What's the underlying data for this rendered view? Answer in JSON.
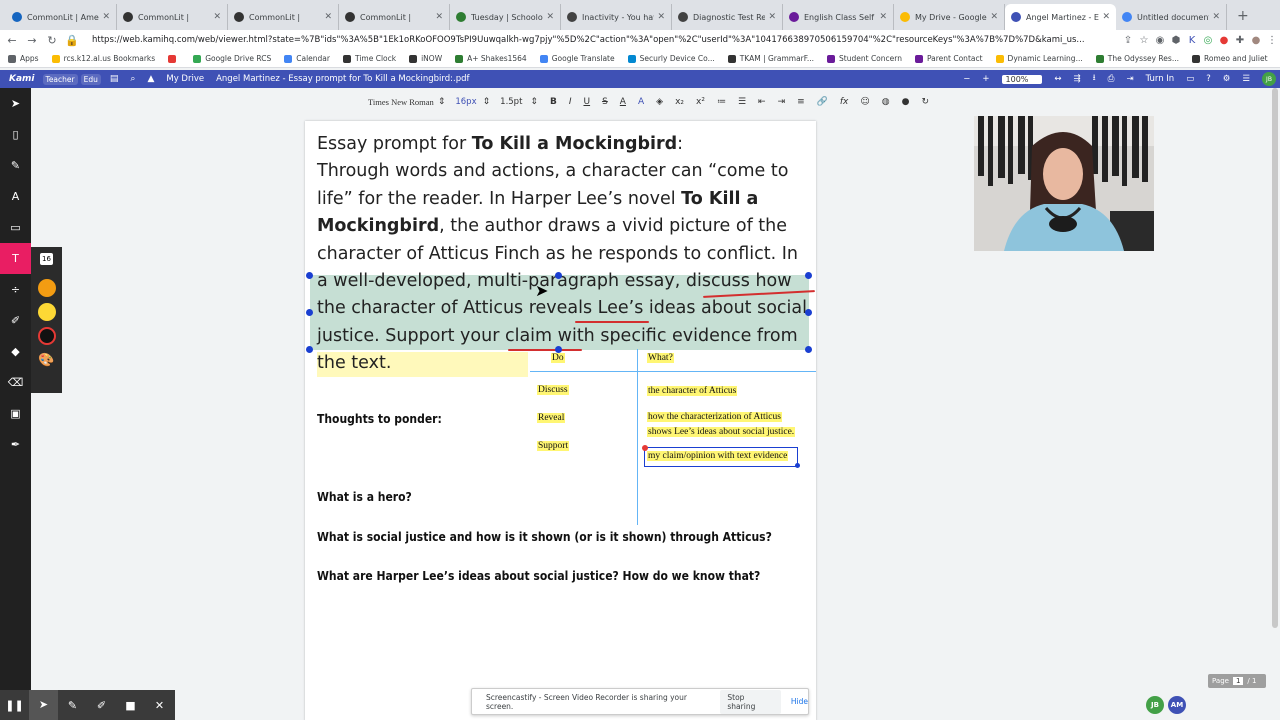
{
  "browser": {
    "tabs": [
      {
        "title": "CommonLit | Americ",
        "color": "#1565c0",
        "active": false
      },
      {
        "title": "CommonLit |",
        "color": "#333333",
        "active": false
      },
      {
        "title": "CommonLit |",
        "color": "#333333",
        "active": false
      },
      {
        "title": "CommonLit |",
        "color": "#333333",
        "active": false
      },
      {
        "title": "Tuesday | Schoolog",
        "color": "#2e7d32",
        "active": false
      },
      {
        "title": "Inactivity - You hav",
        "color": "#424242",
        "active": false
      },
      {
        "title": "Diagnostic Test Rep",
        "color": "#424242",
        "active": false
      },
      {
        "title": "English Class Self A",
        "color": "#6a1b9a",
        "active": false
      },
      {
        "title": "My Drive - Google",
        "color": "#fbbc04",
        "active": false
      },
      {
        "title": "Angel Martinez - Es",
        "color": "#3f51b5",
        "active": true
      },
      {
        "title": "Untitled document",
        "color": "#4285f4",
        "active": false
      }
    ],
    "url": "https://web.kamihq.com/web/viewer.html?state=%7B\"ids\"%3A%5B\"1Ek1oRKoOFOO9TsPI9Uuwqalkh-wg7pjy\"%5D%2C\"action\"%3A\"open\"%2C\"userId\"%3A\"104176638970506159704\"%2C\"resourceKeys\"%3A%7B%7D%7D&kami_us...",
    "bookmarks": [
      {
        "label": "Apps",
        "color": "#5f6368"
      },
      {
        "label": "rcs.k12.al.us Bookmarks",
        "color": "#fbbc04"
      },
      {
        "label": "",
        "color": "#e53935"
      },
      {
        "label": "Google Drive RCS",
        "color": "#34a853"
      },
      {
        "label": "Calendar",
        "color": "#4285f4"
      },
      {
        "label": "Time Clock",
        "color": "#333333"
      },
      {
        "label": "iNOW",
        "color": "#333333"
      },
      {
        "label": "A+ Shakes1564",
        "color": "#2e7d32"
      },
      {
        "label": "Google Translate",
        "color": "#4285f4"
      },
      {
        "label": "Securly Device Co...",
        "color": "#0288d1"
      },
      {
        "label": "TKAM | GrammarF...",
        "color": "#333333"
      },
      {
        "label": "Student Concern",
        "color": "#6a1b9a"
      },
      {
        "label": "Parent Contact",
        "color": "#6a1b9a"
      },
      {
        "label": "Dynamic Learning...",
        "color": "#fbbc04"
      },
      {
        "label": "The Odyssey Res...",
        "color": "#2e7d32"
      },
      {
        "label": "Romeo and Juliet",
        "color": "#333333"
      }
    ]
  },
  "kami": {
    "logo": "Kami",
    "role_teacher": "Teacher",
    "role_edu": "Edu",
    "breadcrumb_drive": "My Drive",
    "doc_title": "Angel Martinez - Essay prompt for To Kill a Mockingbird:.pdf",
    "zoom": "100%",
    "turn_in": "Turn In",
    "avatar": "JB",
    "accent": "#3f51b5"
  },
  "format": {
    "font": "Times New Roman",
    "size": "16px",
    "spacing": "1.5pt"
  },
  "text_panel": {
    "size": "16",
    "swatches": [
      "#f39c12",
      "#fdd835",
      "#111111"
    ]
  },
  "doc": {
    "prompt_lead": "Essay prompt for ",
    "prompt_book": "To Kill a Mockingbird",
    "prompt_colon": ":",
    "body_1": "Through words and actions, a character can “come to life” for the reader.  In Harper Lee’s novel ",
    "body_book": "To Kill a Mockingbird",
    "body_2": ", the author draws a vivid picture of the character of Atticus Finch as he responds to conflict.  In a well-developed, multi-paragraph essay, discuss how the character of Atticus reveals Lee’s ideas about social justice.  Support your claim with specific evidence from the text.",
    "thoughts": "Thoughts to ponder:",
    "q1": "What is a hero?",
    "q2": "What is social justice and how is it shown (or is it shown) through Atticus?",
    "q3": "What are Harper Lee’s ideas about social justice?  How do we know that?",
    "annotations": {
      "do": "Do",
      "what": "What?",
      "discuss": "Discuss",
      "reveal": "Reveal",
      "support": "Support",
      "a1": "the character of Atticus",
      "a2_line1": "how the characterization of Atticus",
      "a2_line2": "shows Lee’s ideas about social justice.",
      "a3": "my claim/opinion with text evidence"
    }
  },
  "screencast": {
    "message": "Screencastify - Screen Video Recorder is sharing your screen.",
    "stop": "Stop sharing",
    "hide": "Hide"
  },
  "pager": {
    "label": "Page",
    "current": "1",
    "total": "/ 1"
  },
  "collaborators": [
    {
      "initials": "JB",
      "color": "#43a047"
    },
    {
      "initials": "AM",
      "color": "#3f51b5"
    }
  ]
}
